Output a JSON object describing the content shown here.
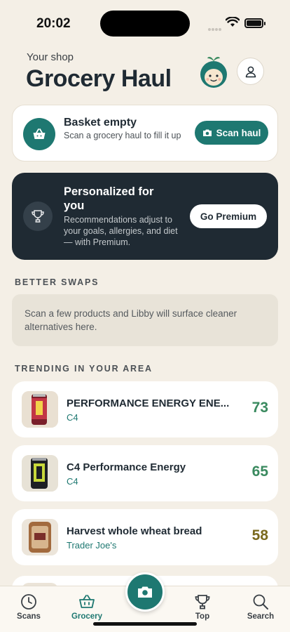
{
  "status_bar": {
    "time": "20:02"
  },
  "header": {
    "eyebrow": "Your shop",
    "title": "Grocery Haul"
  },
  "basket": {
    "title": "Basket empty",
    "subtitle": "Scan a grocery haul to fill it up",
    "button_label": "Scan haul"
  },
  "premium": {
    "title": "Personalized for you",
    "subtitle": "Recommendations adjust to your goals, allergies, and diet — with Premium.",
    "button_label": "Go Premium"
  },
  "swaps": {
    "heading": "BETTER SWAPS",
    "empty_message": "Scan a few products and Libby will surface cleaner alternatives here."
  },
  "trending": {
    "heading": "TRENDING IN YOUR AREA",
    "items": [
      {
        "name": "PERFORMANCE ENERGY ENE...",
        "brand": "C4",
        "score": "73",
        "score_color": "#3a8a5f"
      },
      {
        "name": "C4 Performance Energy",
        "brand": "C4",
        "score": "65",
        "score_color": "#3a8a5f"
      },
      {
        "name": "Harvest whole wheat bread",
        "brand": "Trader Joe's",
        "score": "58",
        "score_color": "#7a6a1e"
      }
    ]
  },
  "tab_bar": {
    "tabs": [
      {
        "label": "Scans",
        "icon": "clock-icon"
      },
      {
        "label": "Grocery",
        "icon": "basket-icon"
      },
      {
        "label": "Top",
        "icon": "trophy-icon"
      },
      {
        "label": "Search",
        "icon": "search-icon"
      }
    ],
    "active": "Grocery",
    "fab_icon": "camera-icon"
  },
  "colors": {
    "accent": "#1e7871",
    "dark_card": "#1f2a33",
    "background": "#f4efe6"
  }
}
